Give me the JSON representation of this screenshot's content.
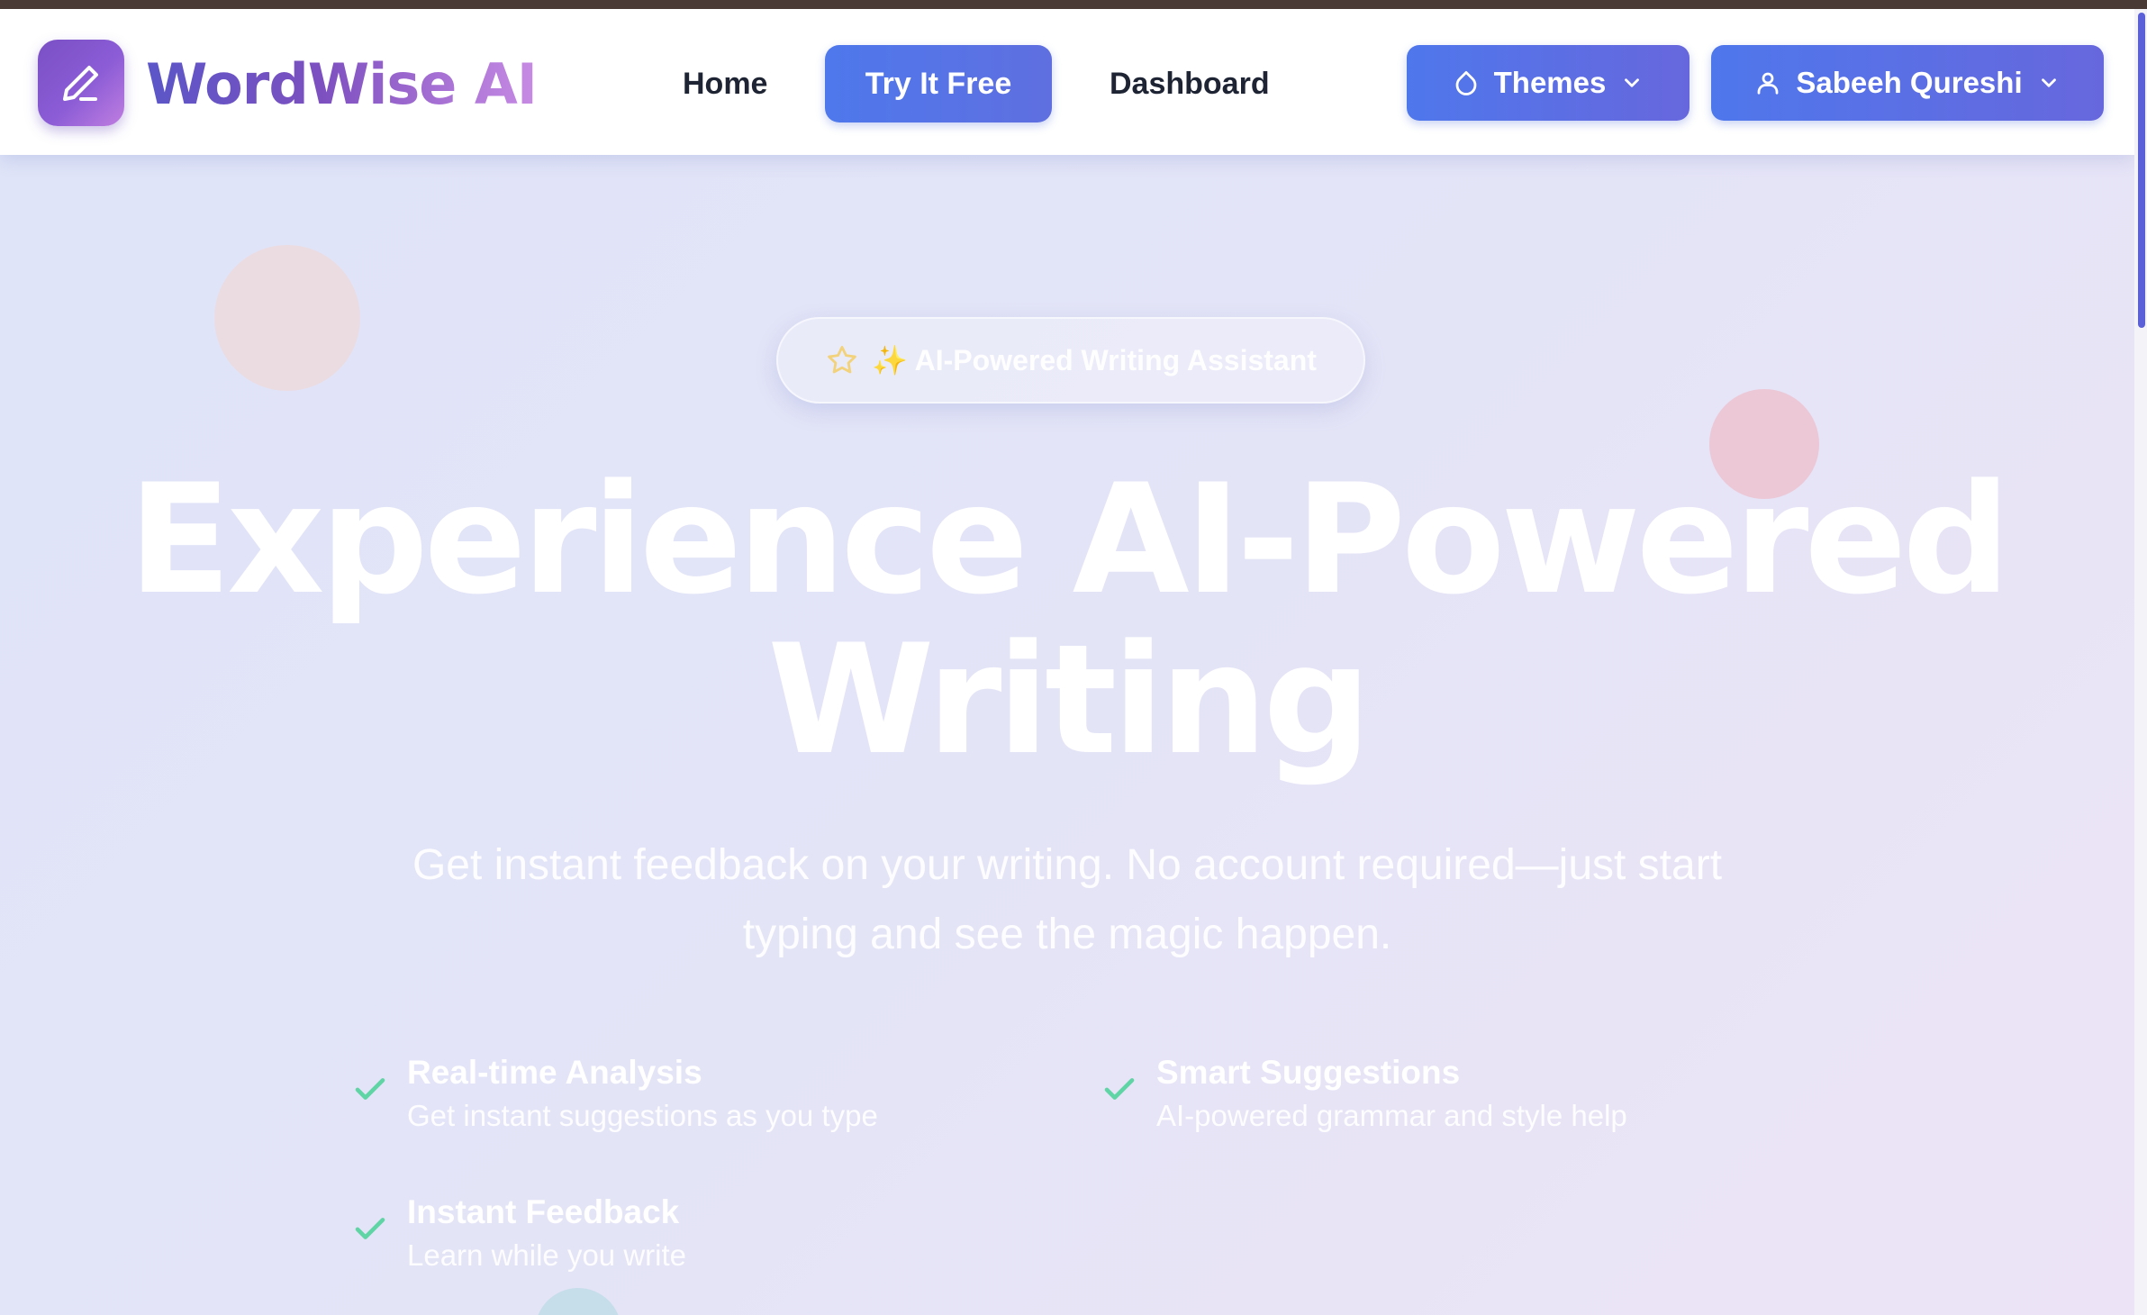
{
  "app": {
    "brand": "WordWise AI",
    "accent_color": "#5b6ee6",
    "logo_icon": "pen-icon"
  },
  "nav": {
    "home": "Home",
    "try_free": "Try It Free",
    "dashboard": "Dashboard",
    "themes": {
      "label": "Themes",
      "icon": "droplet-icon"
    },
    "user": {
      "label": "Sabeeh Qureshi",
      "icon": "user-icon"
    }
  },
  "hero": {
    "badge": "✨ AI-Powered Writing Assistant",
    "badge_icon": "star-icon",
    "title_line1": "Experience AI-Powered",
    "title_line2": "Writing",
    "subtitle_line1": "Get instant feedback on your writing. No account required—just start",
    "subtitle_line2": "typing and see the magic happen.",
    "check_color": "#5fd4a4",
    "features": [
      {
        "title": "Real-time Analysis",
        "desc": "Get instant suggestions as you type"
      },
      {
        "title": "Smart Suggestions",
        "desc": "AI-powered grammar and style help"
      },
      {
        "title": "Instant Feedback",
        "desc": "Learn while you write"
      }
    ]
  }
}
